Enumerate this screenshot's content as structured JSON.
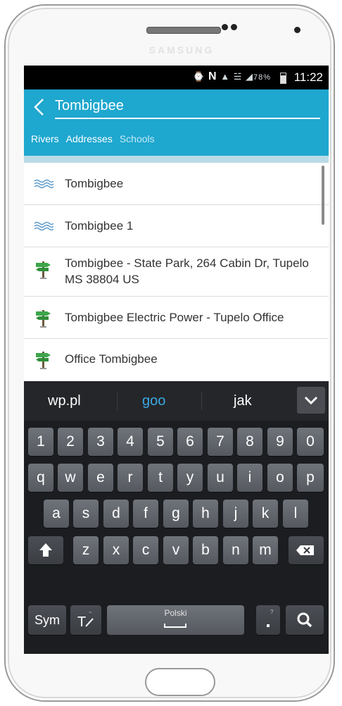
{
  "device": {
    "brand": "SAMSUNG"
  },
  "status_bar": {
    "battery": "78%",
    "time": "11:22"
  },
  "search": {
    "query": "Tombigbee"
  },
  "tabs": [
    "Rivers",
    "Addresses",
    "Schools"
  ],
  "results": [
    {
      "type": "river",
      "icon": "river-icon",
      "text": "Tombigbee"
    },
    {
      "type": "river",
      "icon": "river-icon",
      "text": "Tombigbee 1"
    },
    {
      "type": "address",
      "icon": "signpost-icon",
      "text": "Tombigbee - State Park, 264 Cabin Dr, Tupelo MS 38804 US"
    },
    {
      "type": "address",
      "icon": "signpost-icon",
      "text": "Tombigbee Electric Power - Tupelo Office"
    },
    {
      "type": "address",
      "icon": "signpost-icon",
      "text": "Office Tombigbee"
    }
  ],
  "keyboard": {
    "suggestions": [
      "wp.pl",
      "goo",
      "jak"
    ],
    "highlight_suggestion": "goo",
    "number_row": [
      "1",
      "2",
      "3",
      "4",
      "5",
      "6",
      "7",
      "8",
      "9",
      "0"
    ],
    "row1": [
      "q",
      "w",
      "e",
      "r",
      "t",
      "y",
      "u",
      "i",
      "o",
      "p"
    ],
    "row2": [
      "a",
      "s",
      "d",
      "f",
      "g",
      "h",
      "j",
      "k",
      "l"
    ],
    "row3": [
      "z",
      "x",
      "c",
      "v",
      "b",
      "n",
      "m"
    ],
    "sym_label": "Sym",
    "space_label": "Polski",
    "colors": {
      "accent": "#1ea7cf",
      "suggest_highlight": "#3aa8e0"
    }
  }
}
